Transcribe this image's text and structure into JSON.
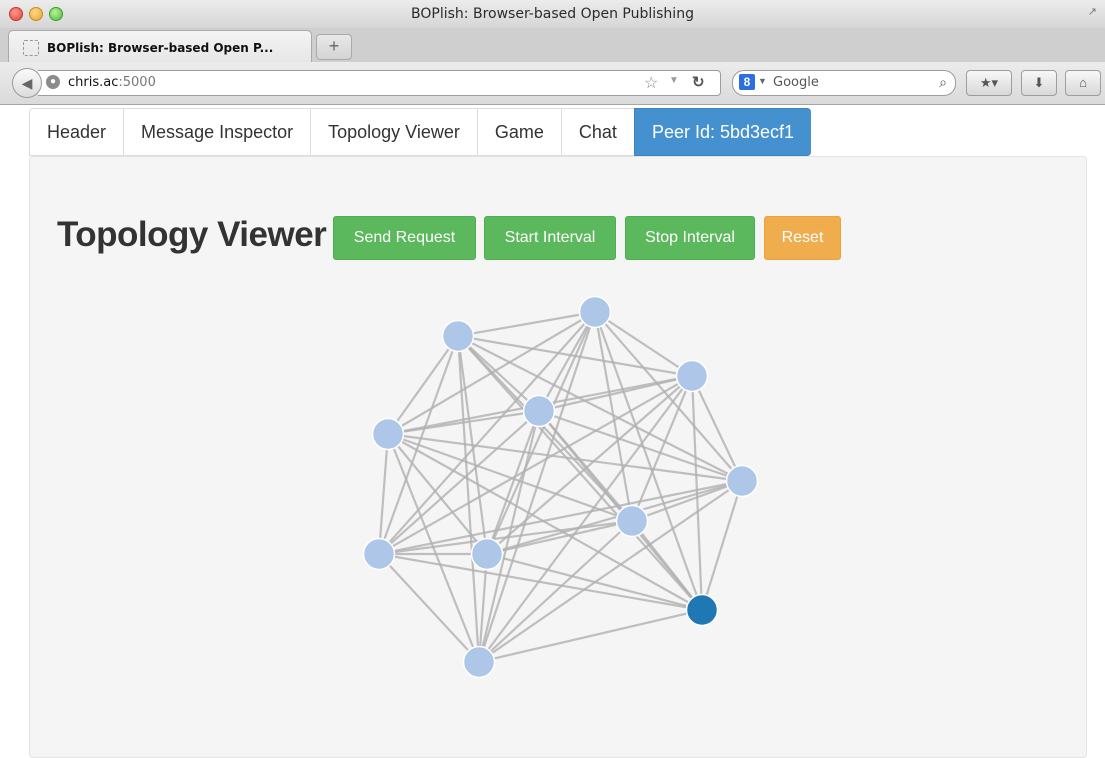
{
  "window": {
    "title": "BOPlish: Browser-based Open Publishing"
  },
  "browser": {
    "tab_title": "BOPlish: Browser-based Open P...",
    "new_tab": "+",
    "url_host": "chris.ac",
    "url_port": ":5000",
    "search_placeholder": "Google",
    "icons": [
      "back-icon",
      "globe-icon",
      "bookmark-star-icon",
      "reload-icon",
      "google-icon",
      "search-icon",
      "bookmarks-icon",
      "downloads-icon",
      "home-icon"
    ]
  },
  "nav": {
    "tabs": [
      {
        "label": "Header"
      },
      {
        "label": "Message Inspector"
      },
      {
        "label": "Topology Viewer"
      },
      {
        "label": "Game"
      },
      {
        "label": "Chat"
      },
      {
        "label": "Peer Id: 5bd3ecf1",
        "active": true
      }
    ]
  },
  "main": {
    "heading": "Topology Viewer",
    "buttons": {
      "send_request": "Send Request",
      "start_interval": "Start Interval",
      "stop_interval": "Stop Interval",
      "reset": "Reset"
    }
  },
  "graph": {
    "node_color": "#aec7e8",
    "self_node_color": "#1f77b4",
    "link_color": "#b0b0b0",
    "node_count": 11,
    "self_node_index": 10,
    "fully_connected": true
  }
}
